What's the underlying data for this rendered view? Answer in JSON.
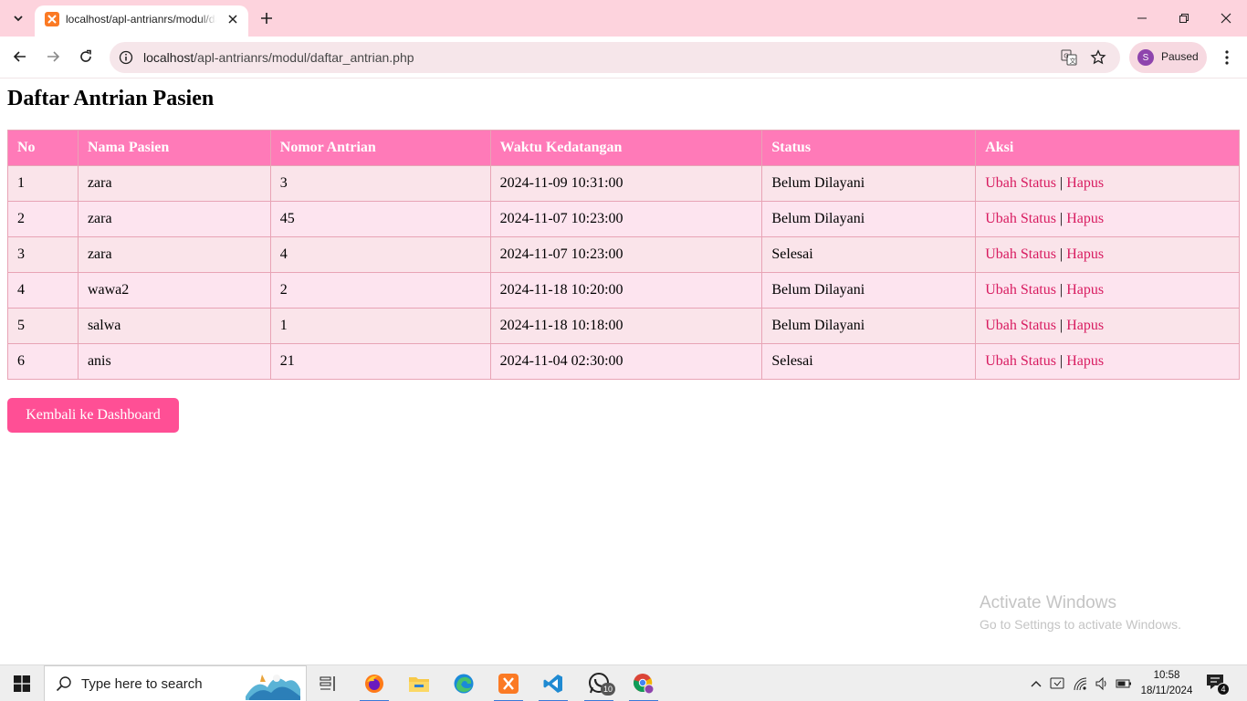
{
  "browser": {
    "tab_title": "localhost/apl-antrianrs/modul/daftar_antrian.php",
    "url_host": "localhost",
    "url_path": "/apl-antrianrs/modul/daftar_antrian.php",
    "profile_initial": "S",
    "profile_status": "Paused"
  },
  "page": {
    "title": "Daftar Antrian Pasien",
    "columns": [
      "No",
      "Nama Pasien",
      "Nomor Antrian",
      "Waktu Kedatangan",
      "Status",
      "Aksi"
    ],
    "rows": [
      {
        "no": "1",
        "nama": "zara",
        "nomor": "3",
        "waktu": "2024-11-09 10:31:00",
        "status": "Belum Dilayani"
      },
      {
        "no": "2",
        "nama": "zara",
        "nomor": "45",
        "waktu": "2024-11-07 10:23:00",
        "status": "Belum Dilayani"
      },
      {
        "no": "3",
        "nama": "zara",
        "nomor": "4",
        "waktu": "2024-11-07 10:23:00",
        "status": "Selesai"
      },
      {
        "no": "4",
        "nama": "wawa2",
        "nomor": "2",
        "waktu": "2024-11-18 10:20:00",
        "status": "Belum Dilayani"
      },
      {
        "no": "5",
        "nama": "salwa",
        "nomor": "1",
        "waktu": "2024-11-18 10:18:00",
        "status": "Belum Dilayani"
      },
      {
        "no": "6",
        "nama": "anis",
        "nomor": "21",
        "waktu": "2024-11-04 02:30:00",
        "status": "Selesai"
      }
    ],
    "action_edit": "Ubah Status",
    "action_separator": "|",
    "action_delete": "Hapus",
    "back_button": "Kembali ke Dashboard"
  },
  "watermark": {
    "title": "Activate Windows",
    "subtitle": "Go to Settings to activate Windows."
  },
  "taskbar": {
    "search_placeholder": "Type here to search",
    "whatsapp_badge": "10",
    "time": "10:58",
    "date": "18/11/2024",
    "notification_count": "4"
  },
  "colors": {
    "header": "#ff7ab8",
    "row_odd": "#fae4ea",
    "row_even": "#fde4ef",
    "link": "#d81b60",
    "button": "#ff4f95",
    "tabstrip": "#fdd3dd"
  },
  "icons": {
    "tab_list": "chevron-down-icon",
    "favicon": "xampp-icon",
    "tab_close": "close-icon",
    "new_tab": "plus-icon",
    "back": "arrow-left-icon",
    "forward": "arrow-right-icon",
    "reload": "reload-icon",
    "site_info": "info-icon",
    "translate": "translate-icon",
    "bookmark": "star-icon",
    "menu": "kebab-menu-icon"
  }
}
